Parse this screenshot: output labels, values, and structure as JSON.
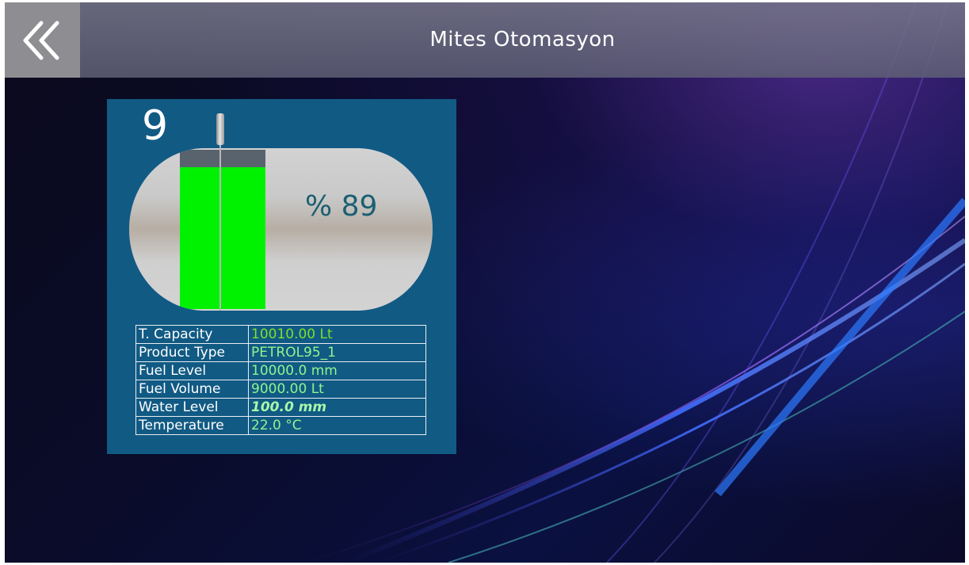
{
  "header": {
    "title": "Mites Otomasyon",
    "back_icon": "double-chevron-left-icon"
  },
  "tank": {
    "number": "9",
    "fill_percent_text": "% 89",
    "fill_fraction": 0.89,
    "fill_color": "#00f200",
    "card_color": "#115a84",
    "details": [
      {
        "label": "T. Capacity",
        "value": "10010.00 Lt"
      },
      {
        "label": "Product Type",
        "value": "PETROL95_1"
      },
      {
        "label": "Fuel Level",
        "value": "10000.0 mm"
      },
      {
        "label": "Fuel Volume",
        "value": "9000.00 Lt"
      },
      {
        "label": "Water Level",
        "value": "100.0 mm"
      },
      {
        "label": "Temperature",
        "value": "22.0 °C"
      }
    ]
  }
}
